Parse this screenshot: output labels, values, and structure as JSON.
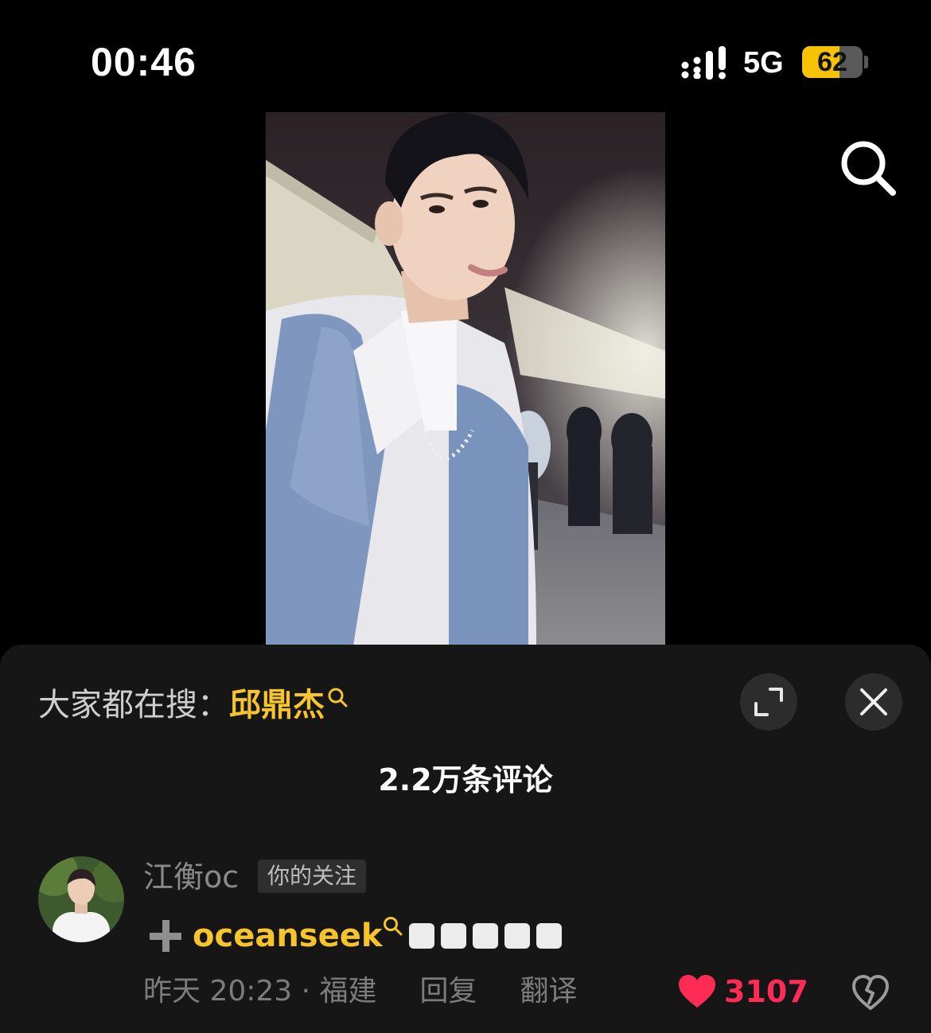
{
  "status_bar": {
    "time": "00:46",
    "network": "5G",
    "battery": "62",
    "battery_level": 0.62
  },
  "icons": {
    "top_search": "search-icon",
    "expand": "expand-icon",
    "close": "close-icon",
    "plus": "plus-icon",
    "like": "heart-icon",
    "dislike": "broken-heart-icon"
  },
  "search_hint": {
    "prefix": "大家都在搜：",
    "keyword": "邱鼎杰"
  },
  "comments": {
    "count_label": "2.2万条评论",
    "items": [
      {
        "username": "江衡oc",
        "badge": "你的关注",
        "link_text": "oceanseek",
        "time_location": "昨天 20:23 · 福建",
        "reply": "回复",
        "translate": "翻译",
        "likes": "3107"
      }
    ]
  },
  "colors": {
    "accent_yellow": "#f7c42c",
    "like_red": "#fe2c55",
    "sheet_bg": "#161616"
  }
}
